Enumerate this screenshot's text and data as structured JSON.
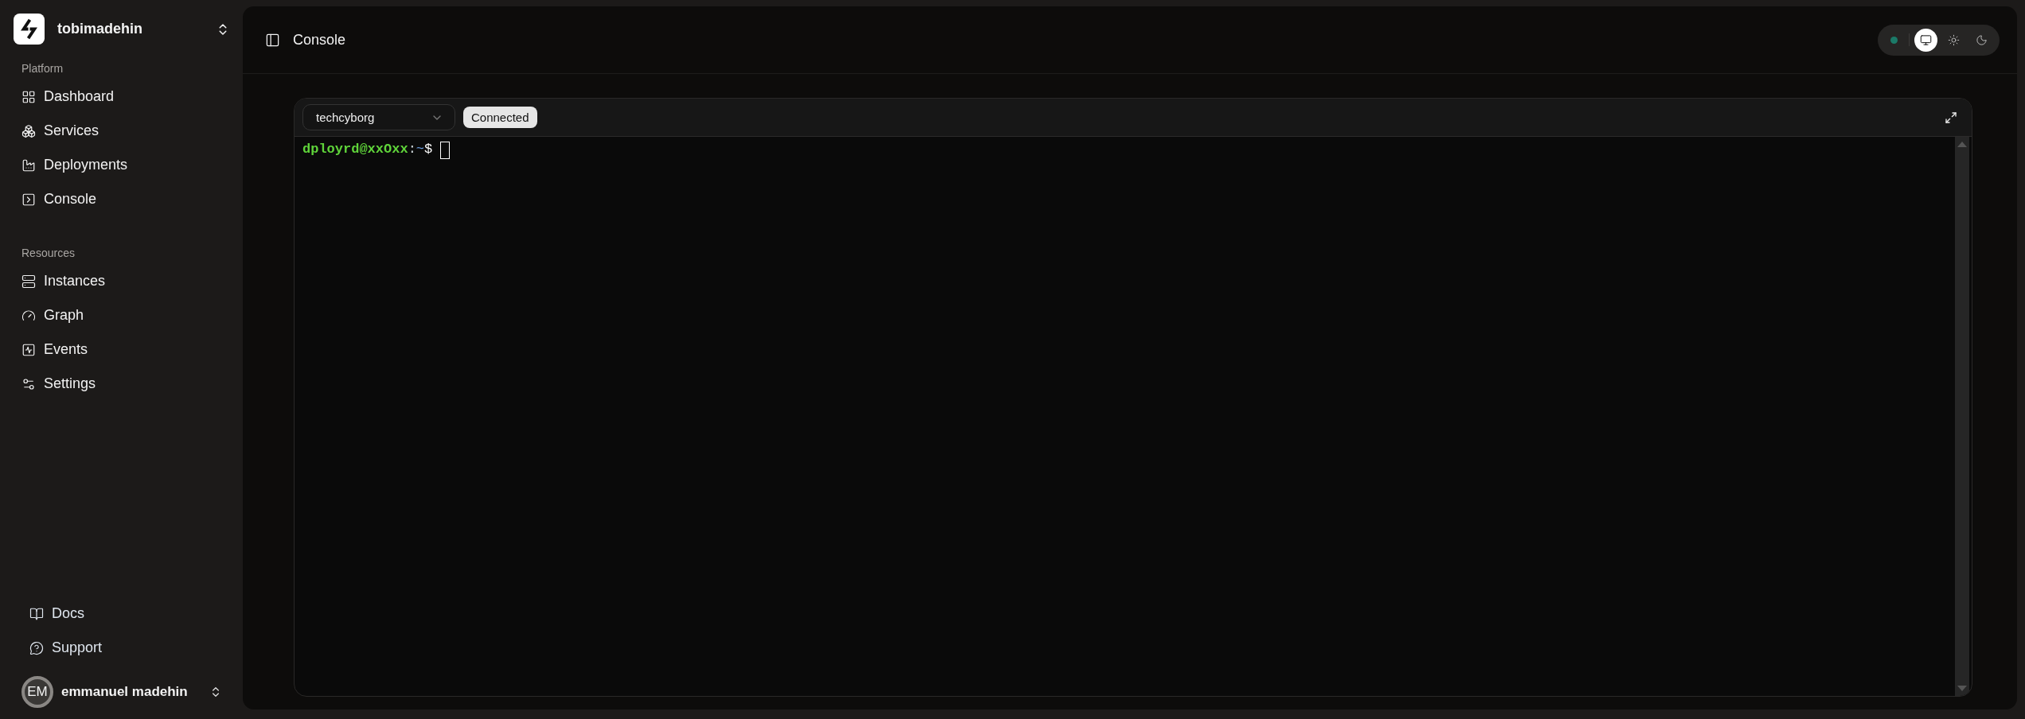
{
  "workspace": {
    "name": "tobimadehin"
  },
  "sidebar": {
    "sections": [
      {
        "label": "Platform",
        "items": [
          {
            "label": "Dashboard"
          },
          {
            "label": "Services"
          },
          {
            "label": "Deployments"
          },
          {
            "label": "Console"
          }
        ]
      },
      {
        "label": "Resources",
        "items": [
          {
            "label": "Instances"
          },
          {
            "label": "Graph"
          },
          {
            "label": "Events"
          },
          {
            "label": "Settings"
          }
        ]
      }
    ],
    "footer_links": [
      {
        "label": "Docs"
      },
      {
        "label": "Support"
      }
    ],
    "user": {
      "initials": "EM",
      "name": "emmanuel madehin"
    }
  },
  "header": {
    "title": "Console",
    "status_dot": {
      "color": "#1b7a68"
    },
    "theme_options": [
      {
        "kind": "system",
        "selected": true
      },
      {
        "kind": "light",
        "selected": false
      },
      {
        "kind": "dark",
        "selected": false
      }
    ]
  },
  "terminal": {
    "host_select": {
      "value": "techcyborg"
    },
    "status_badge": "Connected",
    "prompt": {
      "user_host": "dployrd@xxOxx",
      "separator": ":",
      "path": "~",
      "symbol": "$"
    }
  }
}
